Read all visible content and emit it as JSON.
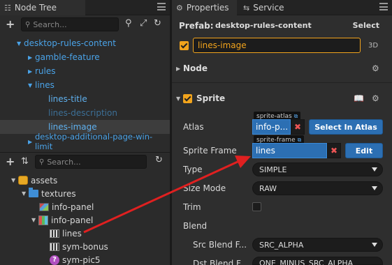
{
  "left_tab": {
    "title": "Node Tree"
  },
  "node_tree": {
    "search_placeholder": "Search...",
    "items": [
      {
        "label": "desktop-rules-content"
      },
      {
        "label": "gamble-feature"
      },
      {
        "label": "rules"
      },
      {
        "label": "lines"
      },
      {
        "label": "lines-title"
      },
      {
        "label": "lines-description"
      },
      {
        "label": "lines-image"
      },
      {
        "label": "desktop-additional-page-win-limit"
      }
    ]
  },
  "assets": {
    "search_placeholder": "Search...",
    "items": [
      {
        "label": "assets"
      },
      {
        "label": "textures"
      },
      {
        "label": "info-panel"
      },
      {
        "label": "info-panel"
      },
      {
        "label": "lines"
      },
      {
        "label": "sym-bonus"
      },
      {
        "label": "sym-pic5"
      }
    ]
  },
  "right_tabs": {
    "properties": "Properties",
    "service": "Service"
  },
  "prefab": {
    "label": "Prefab:",
    "value": "desktop-rules-content",
    "select": "Select"
  },
  "node_name": "lines-image",
  "mode_3d": "3D",
  "sections": {
    "node": "Node",
    "sprite": "Sprite"
  },
  "sprite": {
    "atlas_label": "Atlas",
    "atlas_tag": "sprite-atlas",
    "atlas_value": "info-p...",
    "select_in_atlas": "Select In Atlas",
    "frame_label": "Sprite Frame",
    "frame_tag": "sprite-frame",
    "frame_value": "lines",
    "edit": "Edit",
    "type_label": "Type",
    "type_value": "SIMPLE",
    "size_mode_label": "Size Mode",
    "size_mode_value": "RAW",
    "trim_label": "Trim",
    "blend_label": "Blend",
    "src_blend_label": "Src Blend F...",
    "src_blend_value": "SRC_ALPHA",
    "dst_blend_label": "Dst Blend F...",
    "dst_blend_value": "ONE_MINUS_SRC_ALPHA"
  },
  "colors": {
    "accent_blue": "#2c6fb3",
    "node_blue": "#4aa3e8",
    "checkbox_orange": "#f2a41c",
    "arrow_red": "#e02020"
  }
}
